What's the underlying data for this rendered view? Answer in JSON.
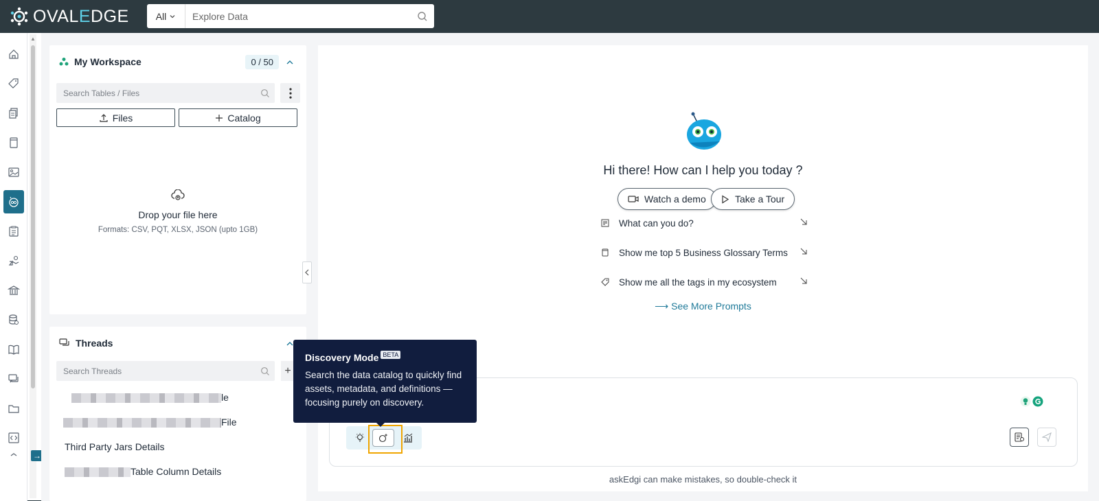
{
  "brand": {
    "name_prefix": "OVAL",
    "name_accent": "E",
    "name_suffix": "DGE"
  },
  "search": {
    "scope": "All",
    "placeholder": "Explore Data"
  },
  "rail": {
    "icons": [
      "home-icon",
      "tag-icon",
      "documents-icon",
      "book-icon",
      "image-report-icon",
      "askedgi-icon",
      "checklist-icon",
      "hand-icon",
      "bank-icon",
      "database-icon",
      "open-book-icon",
      "chat-icon",
      "folder-icon",
      "code-icon",
      "more-icon"
    ],
    "active_index": 5
  },
  "workspace": {
    "title": "My Workspace",
    "count": "0 / 50",
    "search_placeholder": "Search Tables / Files",
    "files_label": "Files",
    "catalog_label": "Catalog",
    "drop_title": "Drop your file here",
    "drop_formats": "Formats: CSV, PQT, XLSX, JSON (upto 1GB)"
  },
  "threads": {
    "title": "Threads",
    "search_placeholder": "Search Threads",
    "items": [
      {
        "visible_text": "le"
      },
      {
        "visible_text": "File"
      },
      {
        "visible_text": "Third Party Jars Details"
      },
      {
        "visible_text": "Table Column Details"
      }
    ]
  },
  "main": {
    "greeting": "Hi there! How can I help you today ?",
    "watch_demo": "Watch a demo",
    "take_tour": "Take a Tour",
    "prompts": [
      {
        "label": "What can you do?",
        "icon": "notes-icon"
      },
      {
        "label": "Show me top 5 Business Glossary Terms",
        "icon": "glossary-icon"
      },
      {
        "label": "Show me all the tags in my ecosystem",
        "icon": "tag-icon"
      }
    ],
    "see_more": "⟶ See More Prompts",
    "disclaimer": "askEdgi can make mistakes, so double-check it"
  },
  "tooltip": {
    "title": "Discovery Mode",
    "badge": "BETA",
    "description": "Search the data catalog to quickly find assets, metadata, and definitions — focusing purely on discovery."
  },
  "colors": {
    "topbar": "#2d3a40",
    "accent": "#1f6f8b",
    "tooltip_bg": "#111d3e",
    "highlight": "#f0a500"
  }
}
